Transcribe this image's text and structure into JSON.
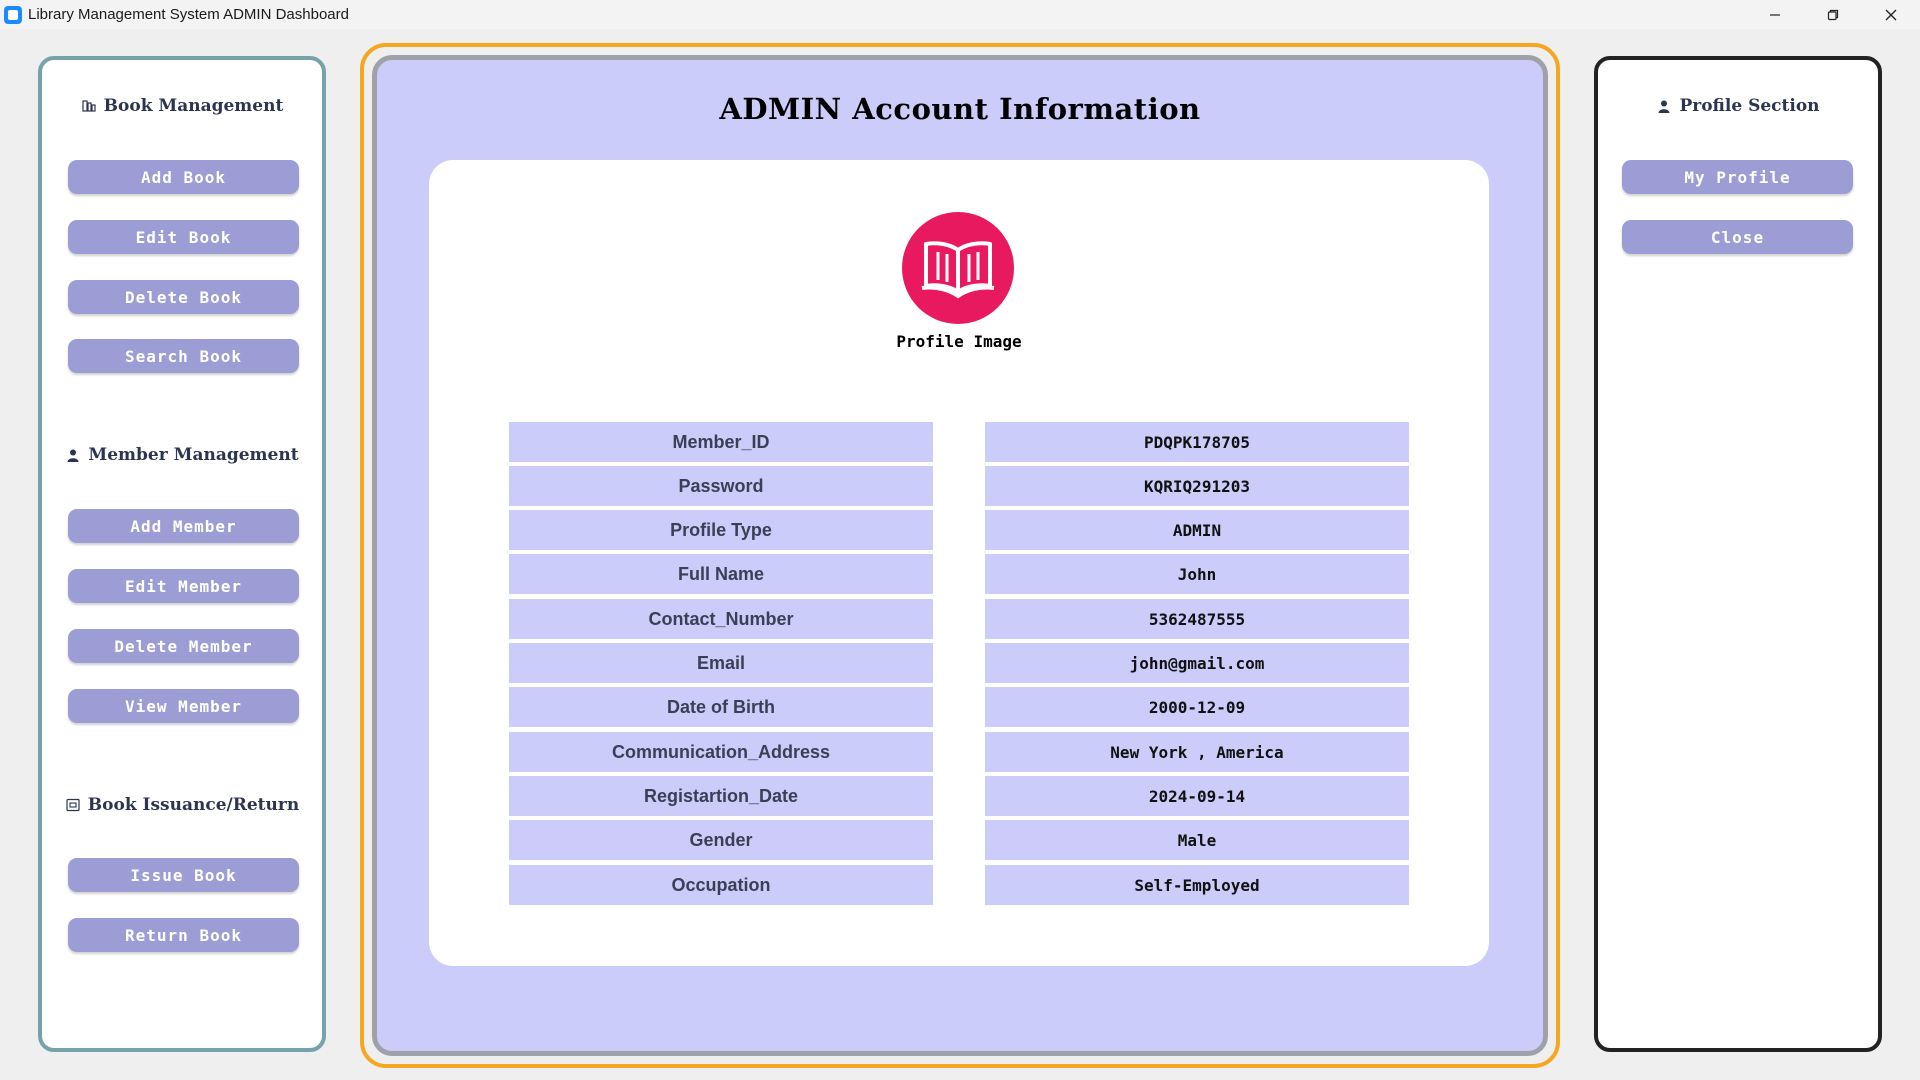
{
  "window": {
    "title": "Library Management System ADMIN Dashboard",
    "controls": [
      "minimize-icon",
      "restore-icon",
      "close-icon"
    ]
  },
  "left_panel": {
    "book_management": {
      "heading": "Book Management",
      "icon": "books-icon",
      "buttons": [
        "Add Book",
        "Edit Book",
        "Delete Book",
        "Search Book"
      ]
    },
    "member_management": {
      "heading": "Member Management",
      "icon": "person-icon",
      "buttons": [
        "Add Member",
        "Edit Member",
        "Delete Member",
        "View Member"
      ]
    },
    "issuance": {
      "heading": "Book Issuance/Return",
      "icon": "ledger-icon",
      "buttons": [
        "Issue Book",
        "Return Book"
      ]
    }
  },
  "right_panel": {
    "heading": "Profile Section",
    "icon": "person-icon",
    "buttons": [
      "My Profile",
      "Close"
    ]
  },
  "main": {
    "title": "ADMIN Account Information",
    "profile_image_label": "Profile Image",
    "profile_image_icon": "open-book-icon",
    "fields": [
      {
        "label": "Member_ID",
        "value": "PDQPK178705"
      },
      {
        "label": "Password",
        "value": "KQRIQ291203"
      },
      {
        "label": "Profile Type",
        "value": "ADMIN"
      },
      {
        "label": "Full Name",
        "value": "John"
      },
      {
        "label": "Contact_Number",
        "value": "5362487555"
      },
      {
        "label": "Email",
        "value": "john@gmail.com"
      },
      {
        "label": "Date of Birth",
        "value": "2000-12-09"
      },
      {
        "label": "Communication_Address",
        "value": "New York , America"
      },
      {
        "label": "Registartion_Date",
        "value": "2024-09-14"
      },
      {
        "label": "Gender",
        "value": "Male"
      },
      {
        "label": "Occupation",
        "value": "Self-Employed"
      }
    ]
  },
  "colors": {
    "accent_button": "#9d9dd6",
    "panel_bg": "#ccccfb",
    "highlight_border": "#f5a623",
    "left_border": "#76a3ab",
    "avatar": "#e8195f"
  }
}
